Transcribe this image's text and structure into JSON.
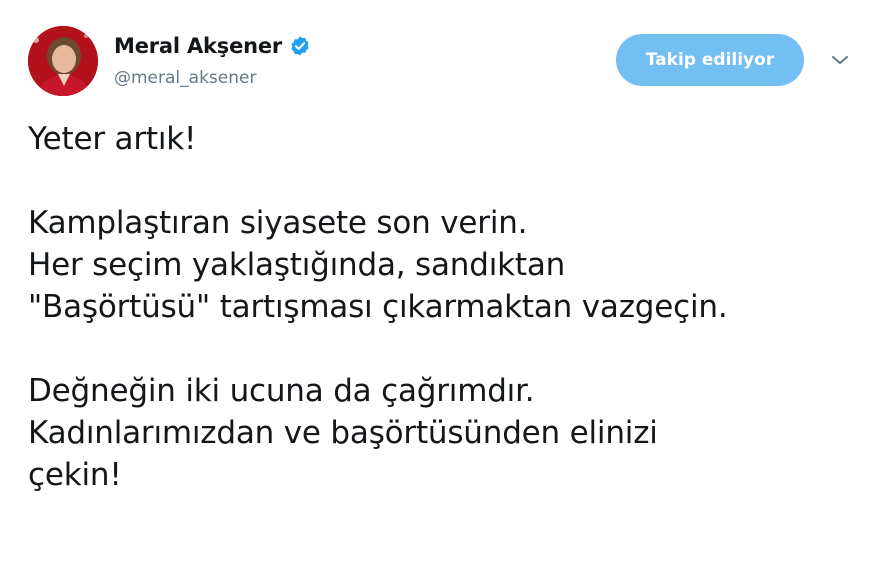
{
  "tweet": {
    "author": {
      "display_name": "Meral Akşener",
      "handle": "@meral_aksener",
      "verified": true
    },
    "follow_button_label": "Takip ediliyor",
    "menu_icon": "chevron-down-icon",
    "lines": [
      "Yeter artık!",
      "",
      "Kamplaştıran siyasete son verin.",
      "Her seçim yaklaştığında, sandıktan",
      "\"Başörtüsü\" tartışması çıkarmaktan vazgeçin.",
      "",
      "Değneğin iki ucuna da çağrımdır.",
      "Kadınlarımızdan ve başörtüsünden elinizi",
      "çekin!"
    ]
  },
  "colors": {
    "follow_button_bg": "#74bff1",
    "verified_badge": "#1da1f2",
    "handle_text": "#657786",
    "body_text": "#14171a"
  }
}
